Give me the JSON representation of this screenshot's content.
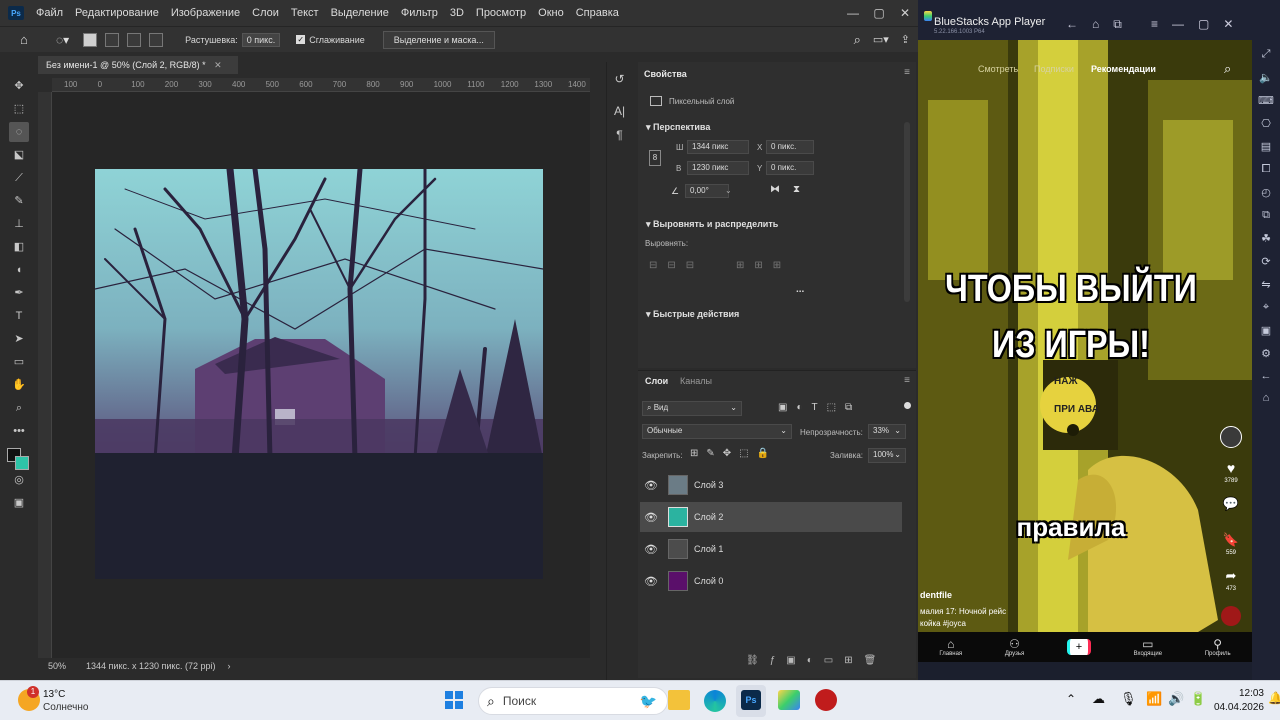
{
  "photoshop": {
    "app_badge": "Ps",
    "menu": [
      "Файл",
      "Редактирование",
      "Изображение",
      "Слои",
      "Текст",
      "Выделение",
      "Фильтр",
      "3D",
      "Просмотр",
      "Окно",
      "Справка"
    ],
    "options": {
      "feather_label": "Растушевка:",
      "feather_value": "0 пикс.",
      "antialias_label": "Сглаживание",
      "select_mask_button": "Выделение и маска..."
    },
    "document_tab": "Без имени-1 @ 50% (Слой 2, RGB/8) *",
    "ruler_marks": [
      "100",
      "0",
      "100",
      "200",
      "300",
      "400",
      "500",
      "600",
      "700",
      "800",
      "900",
      "1000",
      "1100",
      "1200",
      "1300",
      "1400"
    ],
    "status": {
      "zoom": "50%",
      "doc_info": "1344 пикс. x 1230 пикс. (72 ppi)"
    },
    "properties": {
      "tab": "Свойства",
      "layer_kind": "Пиксельный слой",
      "perspective_section": "Перспектива",
      "w_label": "Ш",
      "w_value": "1344 пикс",
      "h_label": "В",
      "h_value": "1230 пикс",
      "x_label": "X",
      "x_value": "0 пикс.",
      "y_label": "Y",
      "y_value": "0 пикс.",
      "angle_value": "0,00°",
      "align_section": "Выровнять и распределить",
      "align_label": "Выровнять:",
      "more": "...",
      "quick_actions": "Быстрые действия"
    },
    "layers_panel": {
      "tab_layers": "Слои",
      "tab_channels": "Каналы",
      "filter_value": "Вид",
      "blend_mode": "Обычные",
      "opacity_label": "Непрозрачность:",
      "opacity_value": "33%",
      "lock_label": "Закрепить:",
      "fill_label": "Заливка:",
      "fill_value": "100%",
      "layers": [
        {
          "name": "Слой 3",
          "thumb_color": "#6b7c86"
        },
        {
          "name": "Слой 2",
          "thumb_color": "#2bb3a0"
        },
        {
          "name": "Слой 1",
          "thumb_color": "#4c4c4c"
        },
        {
          "name": "Слой 0",
          "thumb_color": "#5a0f6a"
        }
      ],
      "selected_index": 1
    }
  },
  "bluestacks": {
    "title": "BlueStacks App Player",
    "version": "5.22.166.1003 P64",
    "tabs": [
      "Смотреть",
      "Подписки",
      "Рекомендации"
    ],
    "overlay_line1": "ЧТОБЫ ВЫЙТИ",
    "overlay_line2": "ИЗ ИГРЫ!",
    "caption": "правила",
    "sign_text_1": "НАЖ",
    "sign_text_2": "ПРИ АВА",
    "username": "dentfile",
    "description_1": "малия 17: Ночной рейс",
    "description_2": "койка #joyca",
    "counts": {
      "likes": "3789",
      "comments": "—",
      "saves": "559",
      "shares": "473"
    },
    "nav": [
      "Главная",
      "Друзья",
      "",
      "Входящие",
      "Профиль"
    ]
  },
  "taskbar": {
    "temperature": "13°C",
    "weather": "Солнечно",
    "weather_badge": "1",
    "search_placeholder": "Поиск",
    "time": "12:03",
    "date": "04.04.2026"
  }
}
